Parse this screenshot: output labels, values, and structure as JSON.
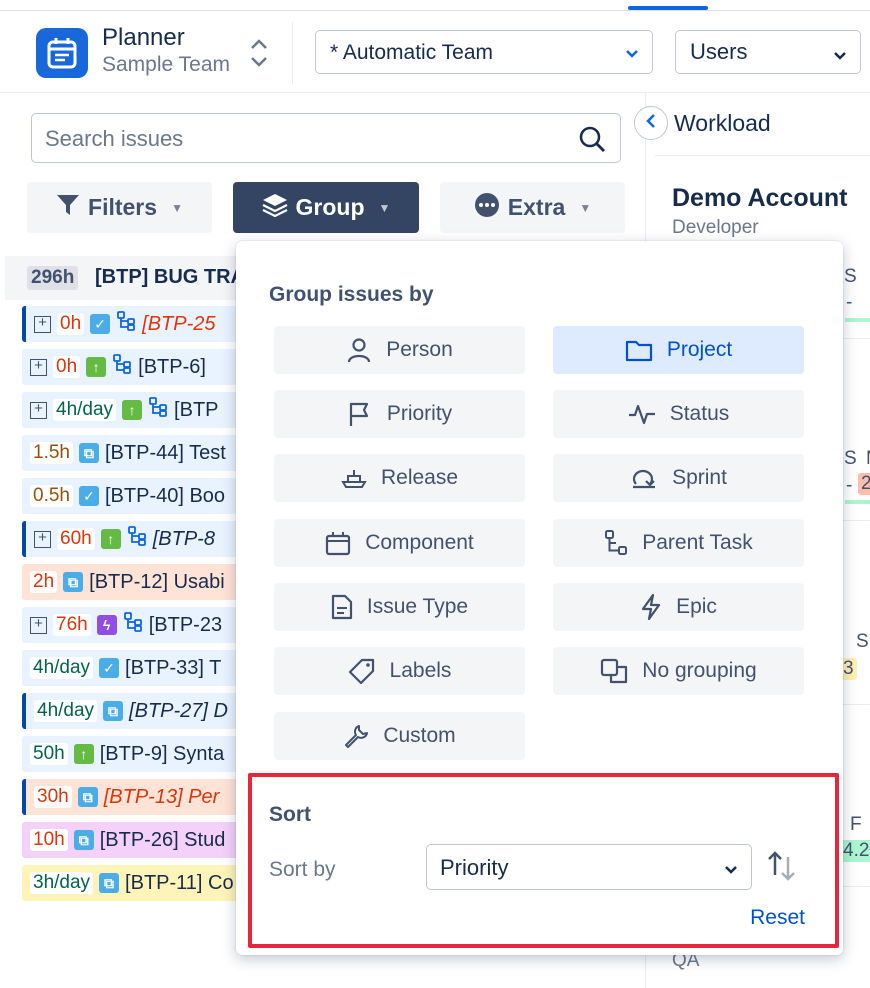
{
  "header": {
    "app_title": "Planner",
    "app_subtitle": "Sample Team",
    "team_select": "* Automatic Team",
    "view_select": "Users"
  },
  "left": {
    "search_placeholder": "Search issues",
    "filters_label": "Filters",
    "group_label": "Group",
    "extra_label": "Extra",
    "group_header": {
      "hours": "296h",
      "title": "[BTP] BUG TRA"
    },
    "issues": [
      {
        "hours": "0h",
        "text": "[BTP-25"
      },
      {
        "hours": "0h",
        "text": "[BTP-6]"
      },
      {
        "hours": "4h/day",
        "text": "[BTP"
      },
      {
        "hours": "1.5h",
        "text": "[BTP-44] Test"
      },
      {
        "hours": "0.5h",
        "text": "[BTP-40] Boo"
      },
      {
        "hours": "60h",
        "text": "[BTP-8"
      },
      {
        "hours": "2h",
        "text": "[BTP-12] Usabi"
      },
      {
        "hours": "76h",
        "text": "[BTP-23"
      },
      {
        "hours": "4h/day",
        "text": "[BTP-33] T"
      },
      {
        "hours": "4h/day",
        "text": "[BTP-27] D"
      },
      {
        "hours": "50h",
        "text": "[BTP-9] Synta"
      },
      {
        "hours": "30h",
        "text": "[BTP-13] Per"
      },
      {
        "hours": "10h",
        "text": "[BTP-26] Stud"
      },
      {
        "hours": "3h/day",
        "text": "[BTP-11] Co"
      }
    ]
  },
  "right": {
    "title": "Workload",
    "account_name": "Demo Account",
    "account_role": "Developer",
    "fragments": [
      "S",
      "-",
      "S",
      "M",
      "-",
      "2",
      "S",
      "3",
      "F",
      "4.2",
      "QA"
    ]
  },
  "group_menu": {
    "title": "Group issues by",
    "options": [
      {
        "label": "Person",
        "icon": "person-icon"
      },
      {
        "label": "Project",
        "icon": "folder-icon",
        "selected": true
      },
      {
        "label": "Priority",
        "icon": "flag-icon"
      },
      {
        "label": "Status",
        "icon": "pulse-icon"
      },
      {
        "label": "Release",
        "icon": "ship-icon"
      },
      {
        "label": "Sprint",
        "icon": "sprint-icon"
      },
      {
        "label": "Component",
        "icon": "component-icon"
      },
      {
        "label": "Parent Task",
        "icon": "hierarchy-icon"
      },
      {
        "label": "Issue Type",
        "icon": "document-icon"
      },
      {
        "label": "Epic",
        "icon": "lightning-icon"
      },
      {
        "label": "Labels",
        "icon": "tag-icon"
      },
      {
        "label": "No grouping",
        "icon": "copy-icon"
      },
      {
        "label": "Custom",
        "icon": "wrench-icon"
      }
    ],
    "sort": {
      "title": "Sort",
      "sort_by_label": "Sort by",
      "sort_by_value": "Priority",
      "reset_label": "Reset"
    }
  }
}
